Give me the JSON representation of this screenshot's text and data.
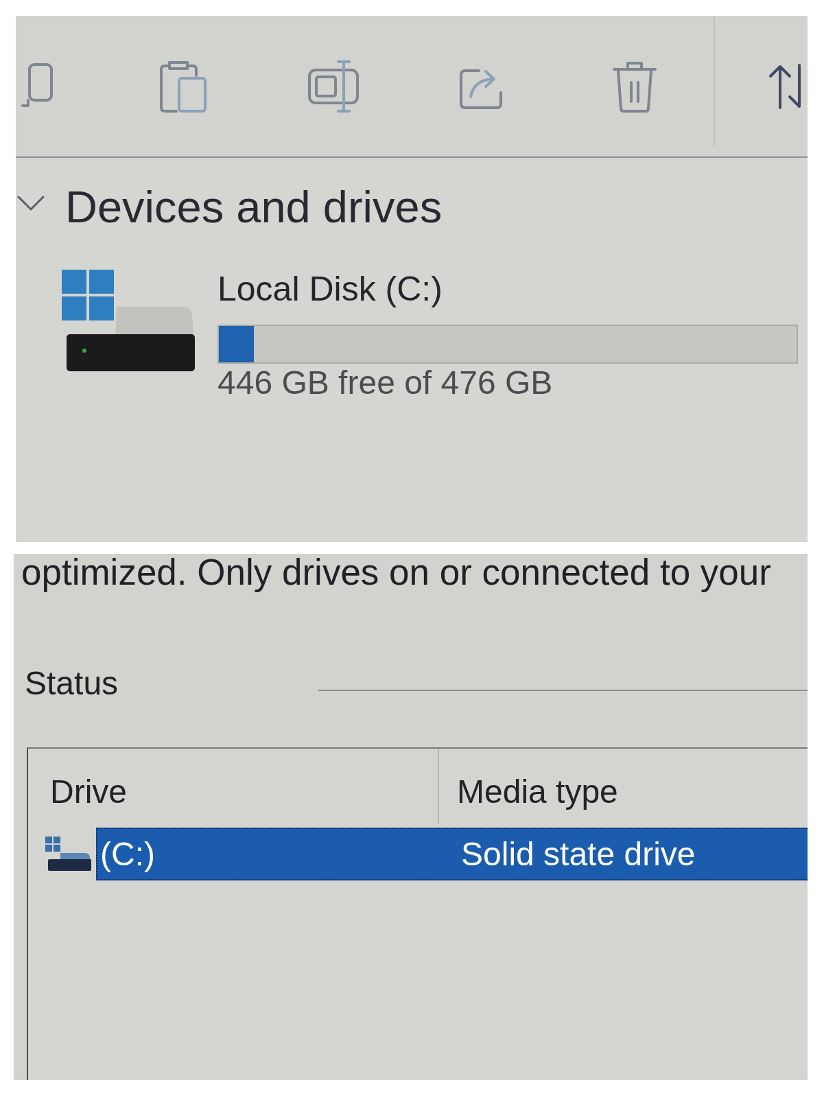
{
  "explorer": {
    "section": {
      "title": "Devices and drives",
      "expanded": true
    },
    "drives": [
      {
        "name": "Local Disk (C:)",
        "level": 0.06,
        "space": "446 GB free of 476 GB"
      }
    ]
  },
  "optimize_drives": {
    "description": "optimized. Only drives on or connected to your",
    "status_label": "Status",
    "table": {
      "columns": [
        "Drive",
        "Media type"
      ],
      "rows": [
        {
          "drive": "(C:)",
          "media_type": "Solid state drive",
          "selected": true
        }
      ]
    }
  }
}
